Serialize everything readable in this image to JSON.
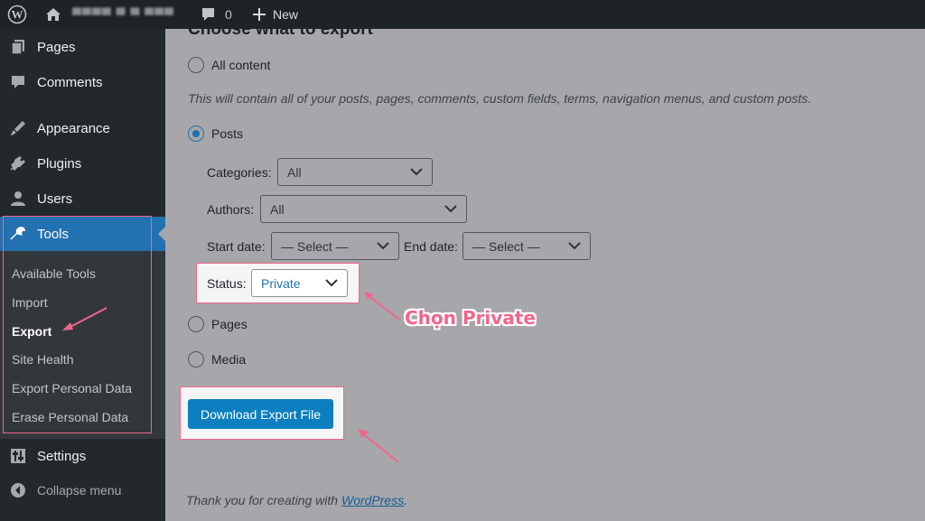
{
  "admin_bar": {
    "site_name": "▀▀▀▀ ▀ ▀ ▀▀▀",
    "comments_count": "0",
    "new_label": "New"
  },
  "sidebar": {
    "items": [
      {
        "label": "Pages",
        "icon": "pages-icon"
      },
      {
        "label": "Comments",
        "icon": "comments-icon"
      },
      {
        "label": "Appearance",
        "icon": "appearance-icon"
      },
      {
        "label": "Plugins",
        "icon": "plugins-icon"
      },
      {
        "label": "Users",
        "icon": "users-icon"
      },
      {
        "label": "Tools",
        "icon": "tools-icon"
      }
    ],
    "submenu": [
      {
        "label": "Available Tools"
      },
      {
        "label": "Import"
      },
      {
        "label": "Export"
      },
      {
        "label": "Site Health"
      },
      {
        "label": "Export Personal Data"
      },
      {
        "label": "Erase Personal Data"
      }
    ],
    "settings_label": "Settings",
    "collapse_label": "Collapse menu",
    "accent_color": "#2271b1"
  },
  "export": {
    "heading_partial": "Choose what to export",
    "all_content_label": "All content",
    "all_content_desc": "This will contain all of your posts, pages, comments, custom fields, terms, navigation menus, and custom posts.",
    "posts_label": "Posts",
    "categories_label": "Categories:",
    "categories_value": "All",
    "authors_label": "Authors:",
    "authors_value": "All",
    "start_date_label": "Start date:",
    "start_date_value": "— Select —",
    "end_date_label": "End date:",
    "end_date_value": "— Select —",
    "status_label": "Status:",
    "status_value": "Private",
    "pages_label": "Pages",
    "media_label": "Media",
    "download_button": "Download Export File",
    "selected_option": "Posts"
  },
  "annotation": {
    "text": "Chọn Private",
    "color": "#f2668b"
  },
  "footer": {
    "thanks_prefix": "Thank you for creating with ",
    "link_text": "WordPress",
    "suffix": "."
  }
}
